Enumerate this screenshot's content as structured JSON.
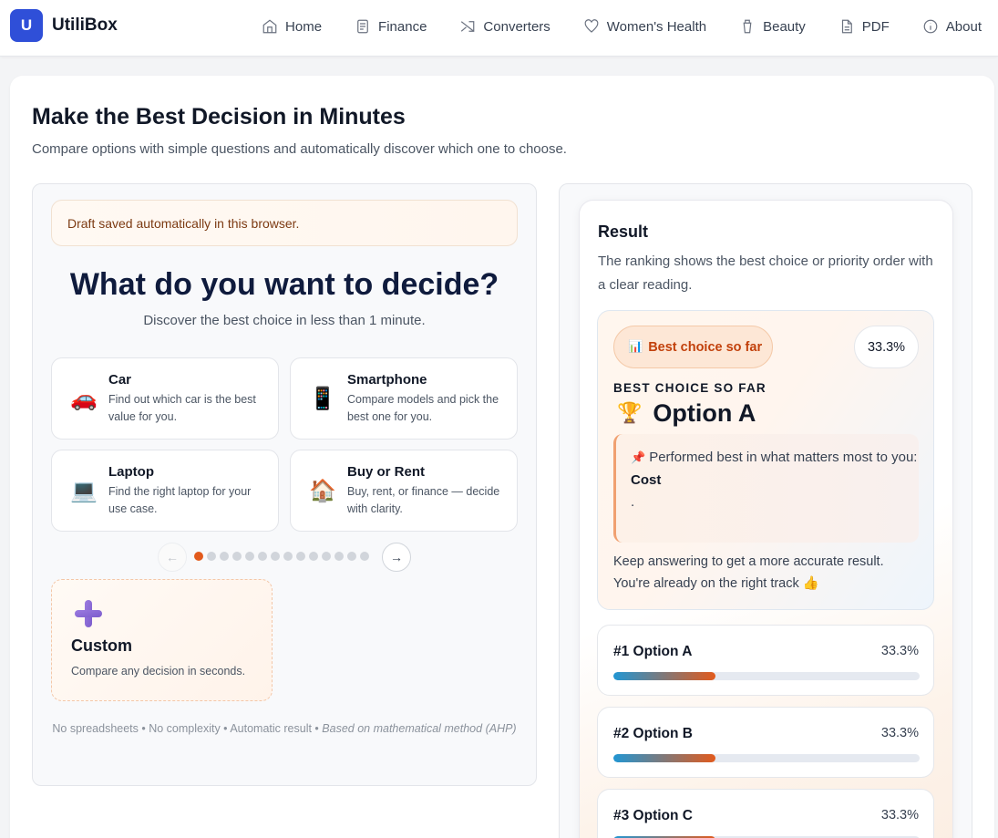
{
  "app": {
    "logo_letter": "U",
    "name": "UtiliBox"
  },
  "nav": [
    {
      "label": "Home",
      "icon": "home-icon"
    },
    {
      "label": "Finance",
      "icon": "document-icon"
    },
    {
      "label": "Converters",
      "icon": "shuffle-icon"
    },
    {
      "label": "Women's Health",
      "icon": "heart-icon"
    },
    {
      "label": "Beauty",
      "icon": "cup-icon"
    },
    {
      "label": "PDF",
      "icon": "file-icon"
    },
    {
      "label": "About",
      "icon": "info-icon"
    }
  ],
  "page": {
    "title": "Make the Best Decision in Minutes",
    "subtitle": "Compare options with simple questions and automatically discover which one to choose."
  },
  "left": {
    "draft_note": "Draft saved automatically in this browser.",
    "heading": "What do you want to decide?",
    "subheading": "Discover the best choice in less than 1 minute.",
    "options": [
      {
        "title": "Car",
        "desc": "Find out which car is the best value for you.",
        "icon": "car-icon"
      },
      {
        "title": "Smartphone",
        "desc": "Compare models and pick the best one for you.",
        "icon": "smartphone-icon"
      },
      {
        "title": "Laptop",
        "desc": "Find the right laptop for your use case.",
        "icon": "laptop-icon"
      },
      {
        "title": "Buy or Rent",
        "desc": "Buy, rent, or finance — decide with clarity.",
        "icon": "house-icon"
      }
    ],
    "carousel": {
      "prev": "←",
      "next": "→",
      "dot_count": 14,
      "active_index": 0
    },
    "custom": {
      "title": "Custom",
      "desc": "Compare any decision in seconds."
    },
    "footnote_plain": "No spreadsheets • No complexity • Automatic result • ",
    "footnote_em": "Based on mathematical method (AHP)"
  },
  "result": {
    "title": "Result",
    "description": "The ranking shows the best choice or priority order with a clear reading.",
    "pill": {
      "icon": "📊",
      "label": "Best choice so far"
    },
    "percent": "33.3%",
    "label": "BEST CHOICE SO FAR",
    "trophy": "🏆",
    "best_option": "Option A",
    "performed_pin": "📌",
    "performed_text": "Performed best in what matters most to you:",
    "criterion": "Cost",
    "criterion_end": ".",
    "keep_text": "Keep answering to get a more accurate result. You're already on the right track",
    "thumb": "👍",
    "ranking": [
      {
        "label": "#1 Option A",
        "percent": "33.3%",
        "value": 0.333
      },
      {
        "label": "#2 Option B",
        "percent": "33.3%",
        "value": 0.333
      },
      {
        "label": "#3 Option C",
        "percent": "33.3%",
        "value": 0.333
      }
    ]
  },
  "colors": {
    "brand": "#2f4fd8",
    "accent": "#e25a1c",
    "bar_start": "#2196d3"
  }
}
